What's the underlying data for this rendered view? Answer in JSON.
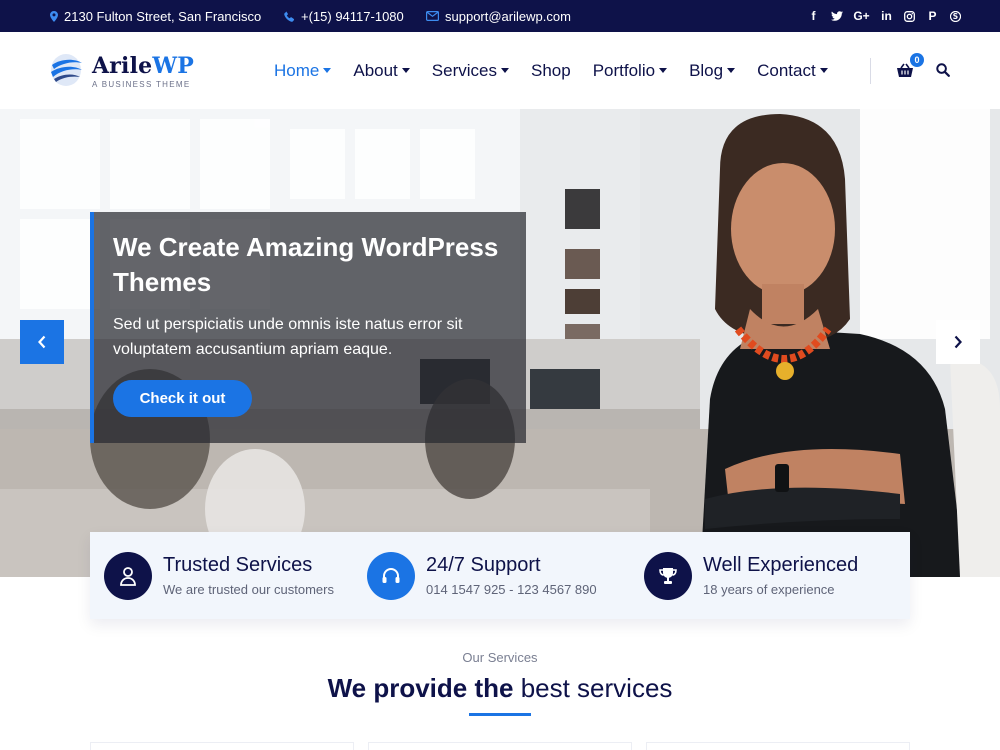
{
  "topbar": {
    "address": "2130 Fulton Street, San Francisco",
    "phone": "+(15) 94117-1080",
    "email": "support@arilewp.com",
    "social_icons": [
      "facebook-icon",
      "twitter-icon",
      "google-plus-icon",
      "linkedin-icon",
      "instagram-icon",
      "pinterest-icon",
      "skype-icon"
    ]
  },
  "logo": {
    "name_part1": "Arile",
    "name_part2": "WP",
    "tagline": "A BUSINESS THEME"
  },
  "nav": {
    "items": [
      {
        "label": "Home",
        "dropdown": true,
        "active": true
      },
      {
        "label": "About",
        "dropdown": true
      },
      {
        "label": "Services",
        "dropdown": true
      },
      {
        "label": "Shop",
        "dropdown": false
      },
      {
        "label": "Portfolio",
        "dropdown": true
      },
      {
        "label": "Blog",
        "dropdown": true
      },
      {
        "label": "Contact",
        "dropdown": true
      }
    ],
    "cart_count": "0"
  },
  "hero": {
    "title": "We Create Amazing WordPress Themes",
    "text": "Sed ut perspiciatis unde omnis iste natus error sit voluptatem accusantium apriam eaque.",
    "button": "Check it out"
  },
  "features": [
    {
      "title": "Trusted Services",
      "desc": "We are trusted our customers",
      "icon": "user-lock-icon"
    },
    {
      "title": "24/7 Support",
      "desc": "014 1547 925 - 123 4567 890",
      "icon": "headset-icon"
    },
    {
      "title": "Well Experienced",
      "desc": "18 years of experience",
      "icon": "trophy-icon"
    }
  ],
  "services": {
    "label": "Our Services",
    "title_strong": "We provide the",
    "title_rest": "best services"
  },
  "colors": {
    "accent": "#1b74e4",
    "navy": "#0e1249",
    "topbar": "#0e1249"
  }
}
